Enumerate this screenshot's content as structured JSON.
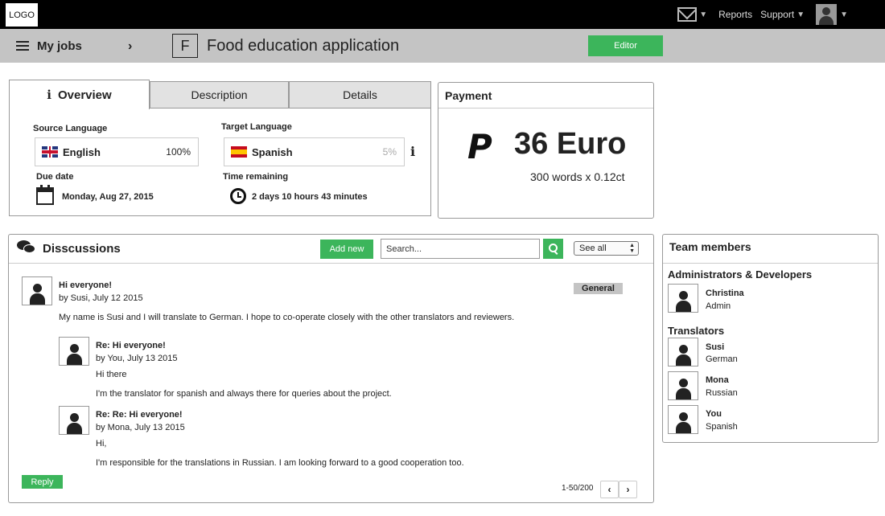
{
  "topbar": {
    "logo": "LOGO",
    "reports": "Reports",
    "support": "Support"
  },
  "subheader": {
    "my_jobs": "My jobs",
    "job_initial": "F",
    "job_title": "Food education application",
    "editor_label": "Editor"
  },
  "overview": {
    "tabs": [
      "Overview",
      "Description",
      "Details"
    ],
    "source_language_label": "Source Language",
    "source_language": "English",
    "source_percent": "100%",
    "target_language_label": "Target Language",
    "target_language": "Spanish",
    "target_percent": "5%",
    "due_date_label": "Due date",
    "due_date": "Monday, Aug 27, 2015",
    "time_remaining_label": "Time remaining",
    "time_remaining": "2 days 10 hours 43 minutes"
  },
  "payment": {
    "title": "Payment",
    "amount": "36 Euro",
    "rate": "300 words x 0.12ct"
  },
  "discussions": {
    "title": "Disscussions",
    "add_new": "Add new",
    "search_placeholder": "Search...",
    "filter": "See all",
    "tag": "General",
    "posts": [
      {
        "title": "Hi everyone!",
        "by": "by Susi, July 12 2015",
        "lines": [
          "My name is Susi and I will translate to German. I hope to co-operate closely with the other translators and reviewers."
        ]
      },
      {
        "title": "Re: Hi everyone!",
        "by": "by You, July 13 2015",
        "lines": [
          "Hi there",
          "I'm the translator for spanish and always there for queries about the project."
        ]
      },
      {
        "title": "Re: Re: Hi everyone!",
        "by": "by Mona, July 13 2015",
        "lines": [
          "Hi,",
          "I'm responsible for the translations in Russian. I am looking forward to a good cooperation too."
        ]
      }
    ],
    "reply": "Reply",
    "pagination": "1-50/200"
  },
  "team": {
    "title": "Team members",
    "admin_section": "Administrators & Developers",
    "translators_section": "Translators",
    "admins": [
      {
        "name": "Christina",
        "role": "Admin"
      }
    ],
    "translators": [
      {
        "name": "Susi",
        "role": "German"
      },
      {
        "name": "Mona",
        "role": "Russian"
      },
      {
        "name": "You",
        "role": "Spanish"
      }
    ]
  },
  "colors": {
    "accent_green": "#3cb55b",
    "topbar": "#000000",
    "subbar": "#c4c4c4"
  }
}
